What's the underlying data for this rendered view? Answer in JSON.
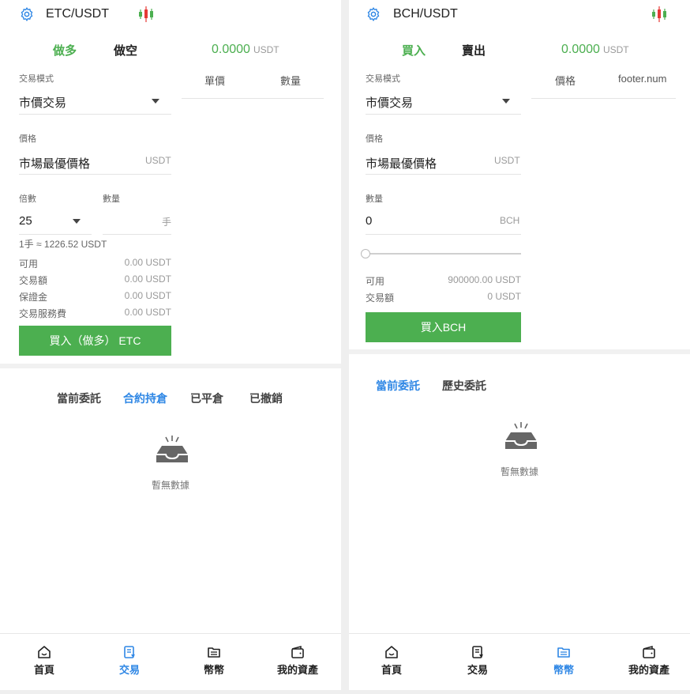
{
  "left": {
    "pair": "ETC/USDT",
    "tabs": {
      "long": "做多",
      "short": "做空"
    },
    "price": "0.0000",
    "price_unit": "USDT",
    "book_headers": [
      "單價",
      "數量"
    ],
    "mode_label": "交易模式",
    "mode_value": "市價交易",
    "price_label": "價格",
    "price_value": "市場最優價格",
    "price_field_unit": "USDT",
    "leverage_label": "倍數",
    "leverage_value": "25",
    "qty_label": "數量",
    "qty_unit": "手",
    "lot_info": "1手 ≈ 1226.52 USDT",
    "info": [
      {
        "label": "可用",
        "value": "0.00 USDT"
      },
      {
        "label": "交易額",
        "value": "0.00 USDT"
      },
      {
        "label": "保證金",
        "value": "0.00 USDT"
      },
      {
        "label": "交易服務費",
        "value": "0.00 USDT"
      }
    ],
    "action_button": "買入（做多） ETC",
    "order_tabs": [
      "當前委託",
      "合約持倉",
      "已平倉",
      "已撤銷"
    ],
    "empty_text": "暫無數據",
    "nav": [
      "首頁",
      "交易",
      "幣幣",
      "我的資產"
    ]
  },
  "right": {
    "pair": "BCH/USDT",
    "tabs": {
      "buy": "買入",
      "sell": "賣出"
    },
    "price": "0.0000",
    "price_unit": "USDT",
    "book_headers": [
      "價格",
      "footer.num"
    ],
    "mode_label": "交易模式",
    "mode_value": "市價交易",
    "price_label": "價格",
    "price_value": "市場最優價格",
    "price_field_unit": "USDT",
    "qty_label": "數量",
    "qty_value": "0",
    "qty_unit": "BCH",
    "slider_value": 0,
    "info": [
      {
        "label": "可用",
        "value": "900000.00 USDT"
      },
      {
        "label": "交易額",
        "value": "0 USDT"
      }
    ],
    "action_button": "買入BCH",
    "order_tabs": [
      "當前委託",
      "歷史委託"
    ],
    "empty_text": "暫無數據",
    "nav": [
      "首頁",
      "交易",
      "幣幣",
      "我的資產"
    ]
  },
  "colors": {
    "green": "#4caf50",
    "blue": "#2f87e5",
    "red": "#e53935"
  }
}
